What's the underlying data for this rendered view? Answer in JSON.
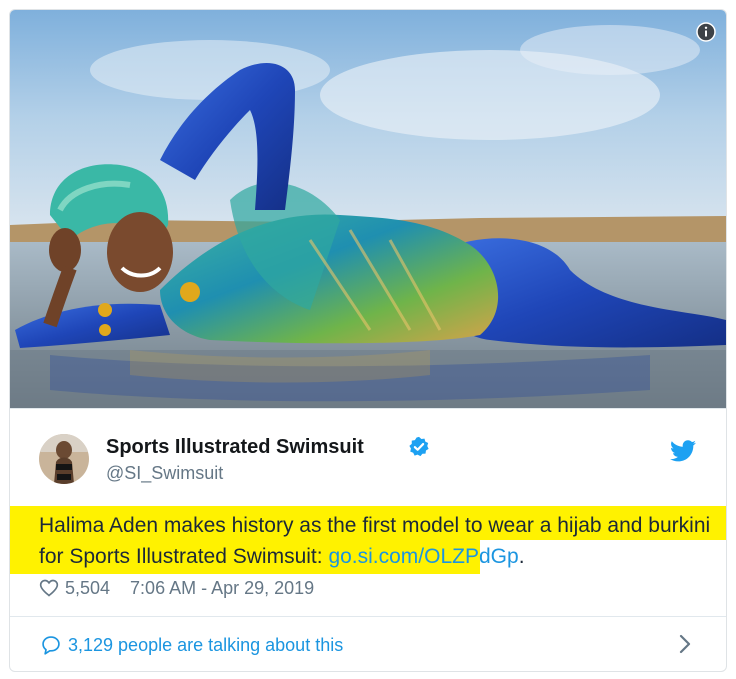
{
  "tweet": {
    "display_name": "Sports Illustrated Swimsuit",
    "handle": "@SI_Swimsuit",
    "text_part1": "Halima Aden makes history as the first model to wear a hijab and burkini for Sports Illustrated Swimsuit: ",
    "link": "go.si.com/OLZPdGp",
    "text_end": ".",
    "likes": "5,504",
    "timestamp": "7:06 AM - Apr 29, 2019",
    "talking": "3,129 people are talking about this"
  },
  "colors": {
    "link_blue": "#1b95e0",
    "highlight": "#fff200",
    "text": "#1c2938",
    "secondary": "#657786"
  },
  "icons": [
    "info-icon",
    "verified-badge-icon",
    "twitter-bird-icon",
    "heart-icon",
    "speech-bubble-icon",
    "chevron-right-icon"
  ]
}
